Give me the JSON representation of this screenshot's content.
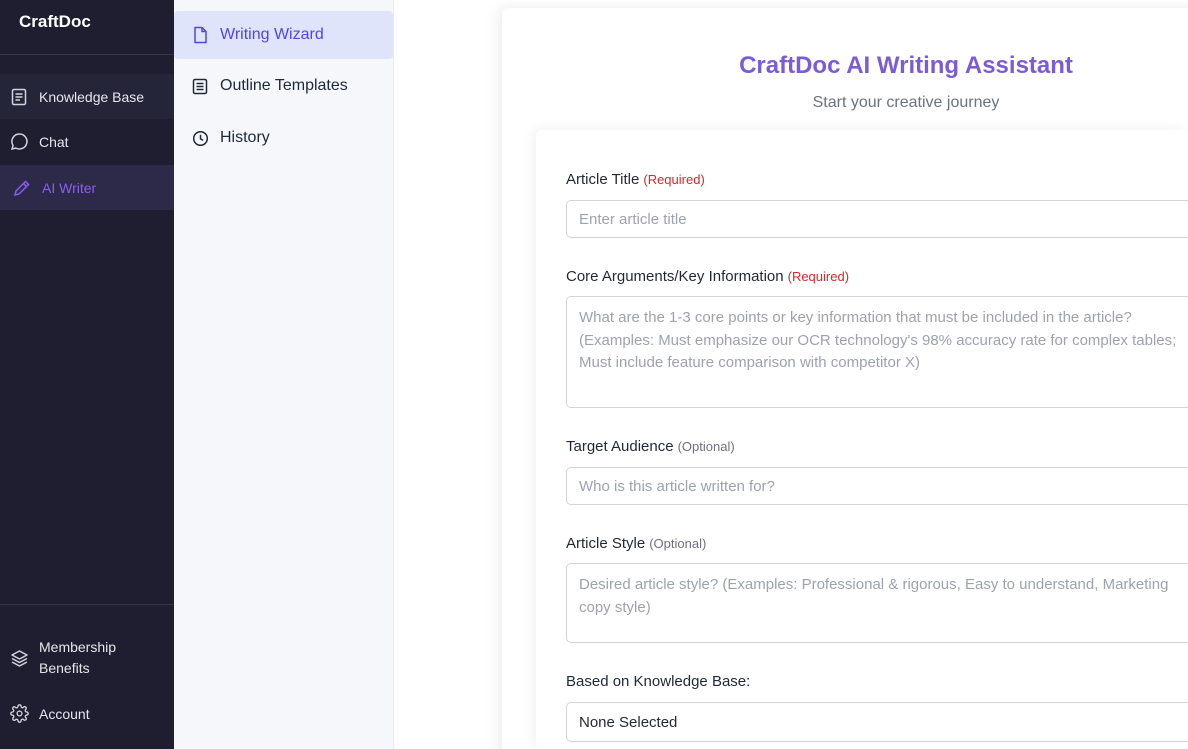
{
  "app": {
    "brand": "CraftDoc"
  },
  "sidebar": {
    "items": [
      {
        "label": "Knowledge Base",
        "icon": "document-icon"
      },
      {
        "label": "Chat",
        "icon": "chat-bubble-icon"
      },
      {
        "label": "AI Writer",
        "icon": "pen-icon",
        "active": true
      }
    ],
    "bottom": [
      {
        "label": "Membership Benefits",
        "icon": "layers-icon"
      },
      {
        "label": "Account",
        "icon": "gear-icon"
      }
    ]
  },
  "subnav": {
    "items": [
      {
        "label": "Writing Wizard",
        "icon": "file-icon",
        "active": true
      },
      {
        "label": "Outline Templates",
        "icon": "template-icon"
      },
      {
        "label": "History",
        "icon": "clock-icon"
      }
    ]
  },
  "main": {
    "title": "CraftDoc AI Writing Assistant",
    "subtitle": "Start your creative journey",
    "form": {
      "article_title": {
        "label": "Article Title",
        "tag": "(Required)",
        "placeholder": "Enter article title"
      },
      "core_arguments": {
        "label": "Core Arguments/Key Information",
        "tag": "(Required)",
        "placeholder": "What are the 1-3 core points or key information that must be included in the article? (Examples: Must emphasize our OCR technology's 98% accuracy rate for complex tables; Must include feature comparison with competitor X)"
      },
      "target_audience": {
        "label": "Target Audience",
        "tag": "(Optional)",
        "placeholder": "Who is this article written for?"
      },
      "article_style": {
        "label": "Article Style",
        "tag": "(Optional)",
        "placeholder": "Desired article style? (Examples: Professional & rigorous, Easy to understand, Marketing copy style)"
      },
      "knowledge_base": {
        "label": "Based on Knowledge Base:",
        "value": "None Selected"
      }
    }
  },
  "colors": {
    "sidebar_bg": "#1e1e30",
    "accent": "#8b5cf6",
    "title": "#7c5cd6",
    "required": "#dc2626",
    "subnav_active_bg": "#e0e4fb"
  }
}
